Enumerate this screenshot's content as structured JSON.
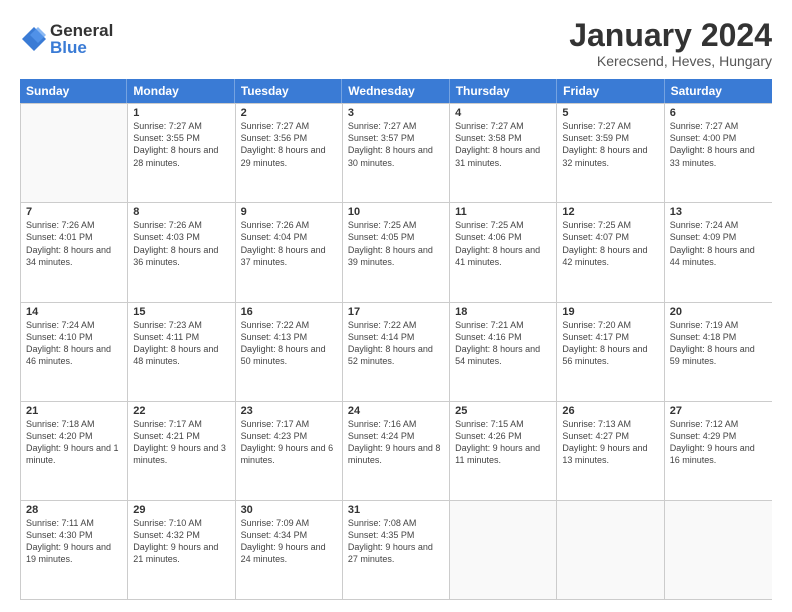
{
  "logo": {
    "general": "General",
    "blue": "Blue"
  },
  "header": {
    "month": "January 2024",
    "location": "Kerecsend, Heves, Hungary"
  },
  "days": [
    "Sunday",
    "Monday",
    "Tuesday",
    "Wednesday",
    "Thursday",
    "Friday",
    "Saturday"
  ],
  "rows": [
    [
      {
        "day": "",
        "sunrise": "",
        "sunset": "",
        "daylight": ""
      },
      {
        "day": "1",
        "sunrise": "Sunrise: 7:27 AM",
        "sunset": "Sunset: 3:55 PM",
        "daylight": "Daylight: 8 hours and 28 minutes."
      },
      {
        "day": "2",
        "sunrise": "Sunrise: 7:27 AM",
        "sunset": "Sunset: 3:56 PM",
        "daylight": "Daylight: 8 hours and 29 minutes."
      },
      {
        "day": "3",
        "sunrise": "Sunrise: 7:27 AM",
        "sunset": "Sunset: 3:57 PM",
        "daylight": "Daylight: 8 hours and 30 minutes."
      },
      {
        "day": "4",
        "sunrise": "Sunrise: 7:27 AM",
        "sunset": "Sunset: 3:58 PM",
        "daylight": "Daylight: 8 hours and 31 minutes."
      },
      {
        "day": "5",
        "sunrise": "Sunrise: 7:27 AM",
        "sunset": "Sunset: 3:59 PM",
        "daylight": "Daylight: 8 hours and 32 minutes."
      },
      {
        "day": "6",
        "sunrise": "Sunrise: 7:27 AM",
        "sunset": "Sunset: 4:00 PM",
        "daylight": "Daylight: 8 hours and 33 minutes."
      }
    ],
    [
      {
        "day": "7",
        "sunrise": "Sunrise: 7:26 AM",
        "sunset": "Sunset: 4:01 PM",
        "daylight": "Daylight: 8 hours and 34 minutes."
      },
      {
        "day": "8",
        "sunrise": "Sunrise: 7:26 AM",
        "sunset": "Sunset: 4:03 PM",
        "daylight": "Daylight: 8 hours and 36 minutes."
      },
      {
        "day": "9",
        "sunrise": "Sunrise: 7:26 AM",
        "sunset": "Sunset: 4:04 PM",
        "daylight": "Daylight: 8 hours and 37 minutes."
      },
      {
        "day": "10",
        "sunrise": "Sunrise: 7:25 AM",
        "sunset": "Sunset: 4:05 PM",
        "daylight": "Daylight: 8 hours and 39 minutes."
      },
      {
        "day": "11",
        "sunrise": "Sunrise: 7:25 AM",
        "sunset": "Sunset: 4:06 PM",
        "daylight": "Daylight: 8 hours and 41 minutes."
      },
      {
        "day": "12",
        "sunrise": "Sunrise: 7:25 AM",
        "sunset": "Sunset: 4:07 PM",
        "daylight": "Daylight: 8 hours and 42 minutes."
      },
      {
        "day": "13",
        "sunrise": "Sunrise: 7:24 AM",
        "sunset": "Sunset: 4:09 PM",
        "daylight": "Daylight: 8 hours and 44 minutes."
      }
    ],
    [
      {
        "day": "14",
        "sunrise": "Sunrise: 7:24 AM",
        "sunset": "Sunset: 4:10 PM",
        "daylight": "Daylight: 8 hours and 46 minutes."
      },
      {
        "day": "15",
        "sunrise": "Sunrise: 7:23 AM",
        "sunset": "Sunset: 4:11 PM",
        "daylight": "Daylight: 8 hours and 48 minutes."
      },
      {
        "day": "16",
        "sunrise": "Sunrise: 7:22 AM",
        "sunset": "Sunset: 4:13 PM",
        "daylight": "Daylight: 8 hours and 50 minutes."
      },
      {
        "day": "17",
        "sunrise": "Sunrise: 7:22 AM",
        "sunset": "Sunset: 4:14 PM",
        "daylight": "Daylight: 8 hours and 52 minutes."
      },
      {
        "day": "18",
        "sunrise": "Sunrise: 7:21 AM",
        "sunset": "Sunset: 4:16 PM",
        "daylight": "Daylight: 8 hours and 54 minutes."
      },
      {
        "day": "19",
        "sunrise": "Sunrise: 7:20 AM",
        "sunset": "Sunset: 4:17 PM",
        "daylight": "Daylight: 8 hours and 56 minutes."
      },
      {
        "day": "20",
        "sunrise": "Sunrise: 7:19 AM",
        "sunset": "Sunset: 4:18 PM",
        "daylight": "Daylight: 8 hours and 59 minutes."
      }
    ],
    [
      {
        "day": "21",
        "sunrise": "Sunrise: 7:18 AM",
        "sunset": "Sunset: 4:20 PM",
        "daylight": "Daylight: 9 hours and 1 minute."
      },
      {
        "day": "22",
        "sunrise": "Sunrise: 7:17 AM",
        "sunset": "Sunset: 4:21 PM",
        "daylight": "Daylight: 9 hours and 3 minutes."
      },
      {
        "day": "23",
        "sunrise": "Sunrise: 7:17 AM",
        "sunset": "Sunset: 4:23 PM",
        "daylight": "Daylight: 9 hours and 6 minutes."
      },
      {
        "day": "24",
        "sunrise": "Sunrise: 7:16 AM",
        "sunset": "Sunset: 4:24 PM",
        "daylight": "Daylight: 9 hours and 8 minutes."
      },
      {
        "day": "25",
        "sunrise": "Sunrise: 7:15 AM",
        "sunset": "Sunset: 4:26 PM",
        "daylight": "Daylight: 9 hours and 11 minutes."
      },
      {
        "day": "26",
        "sunrise": "Sunrise: 7:13 AM",
        "sunset": "Sunset: 4:27 PM",
        "daylight": "Daylight: 9 hours and 13 minutes."
      },
      {
        "day": "27",
        "sunrise": "Sunrise: 7:12 AM",
        "sunset": "Sunset: 4:29 PM",
        "daylight": "Daylight: 9 hours and 16 minutes."
      }
    ],
    [
      {
        "day": "28",
        "sunrise": "Sunrise: 7:11 AM",
        "sunset": "Sunset: 4:30 PM",
        "daylight": "Daylight: 9 hours and 19 minutes."
      },
      {
        "day": "29",
        "sunrise": "Sunrise: 7:10 AM",
        "sunset": "Sunset: 4:32 PM",
        "daylight": "Daylight: 9 hours and 21 minutes."
      },
      {
        "day": "30",
        "sunrise": "Sunrise: 7:09 AM",
        "sunset": "Sunset: 4:34 PM",
        "daylight": "Daylight: 9 hours and 24 minutes."
      },
      {
        "day": "31",
        "sunrise": "Sunrise: 7:08 AM",
        "sunset": "Sunset: 4:35 PM",
        "daylight": "Daylight: 9 hours and 27 minutes."
      },
      {
        "day": "",
        "sunrise": "",
        "sunset": "",
        "daylight": ""
      },
      {
        "day": "",
        "sunrise": "",
        "sunset": "",
        "daylight": ""
      },
      {
        "day": "",
        "sunrise": "",
        "sunset": "",
        "daylight": ""
      }
    ]
  ]
}
